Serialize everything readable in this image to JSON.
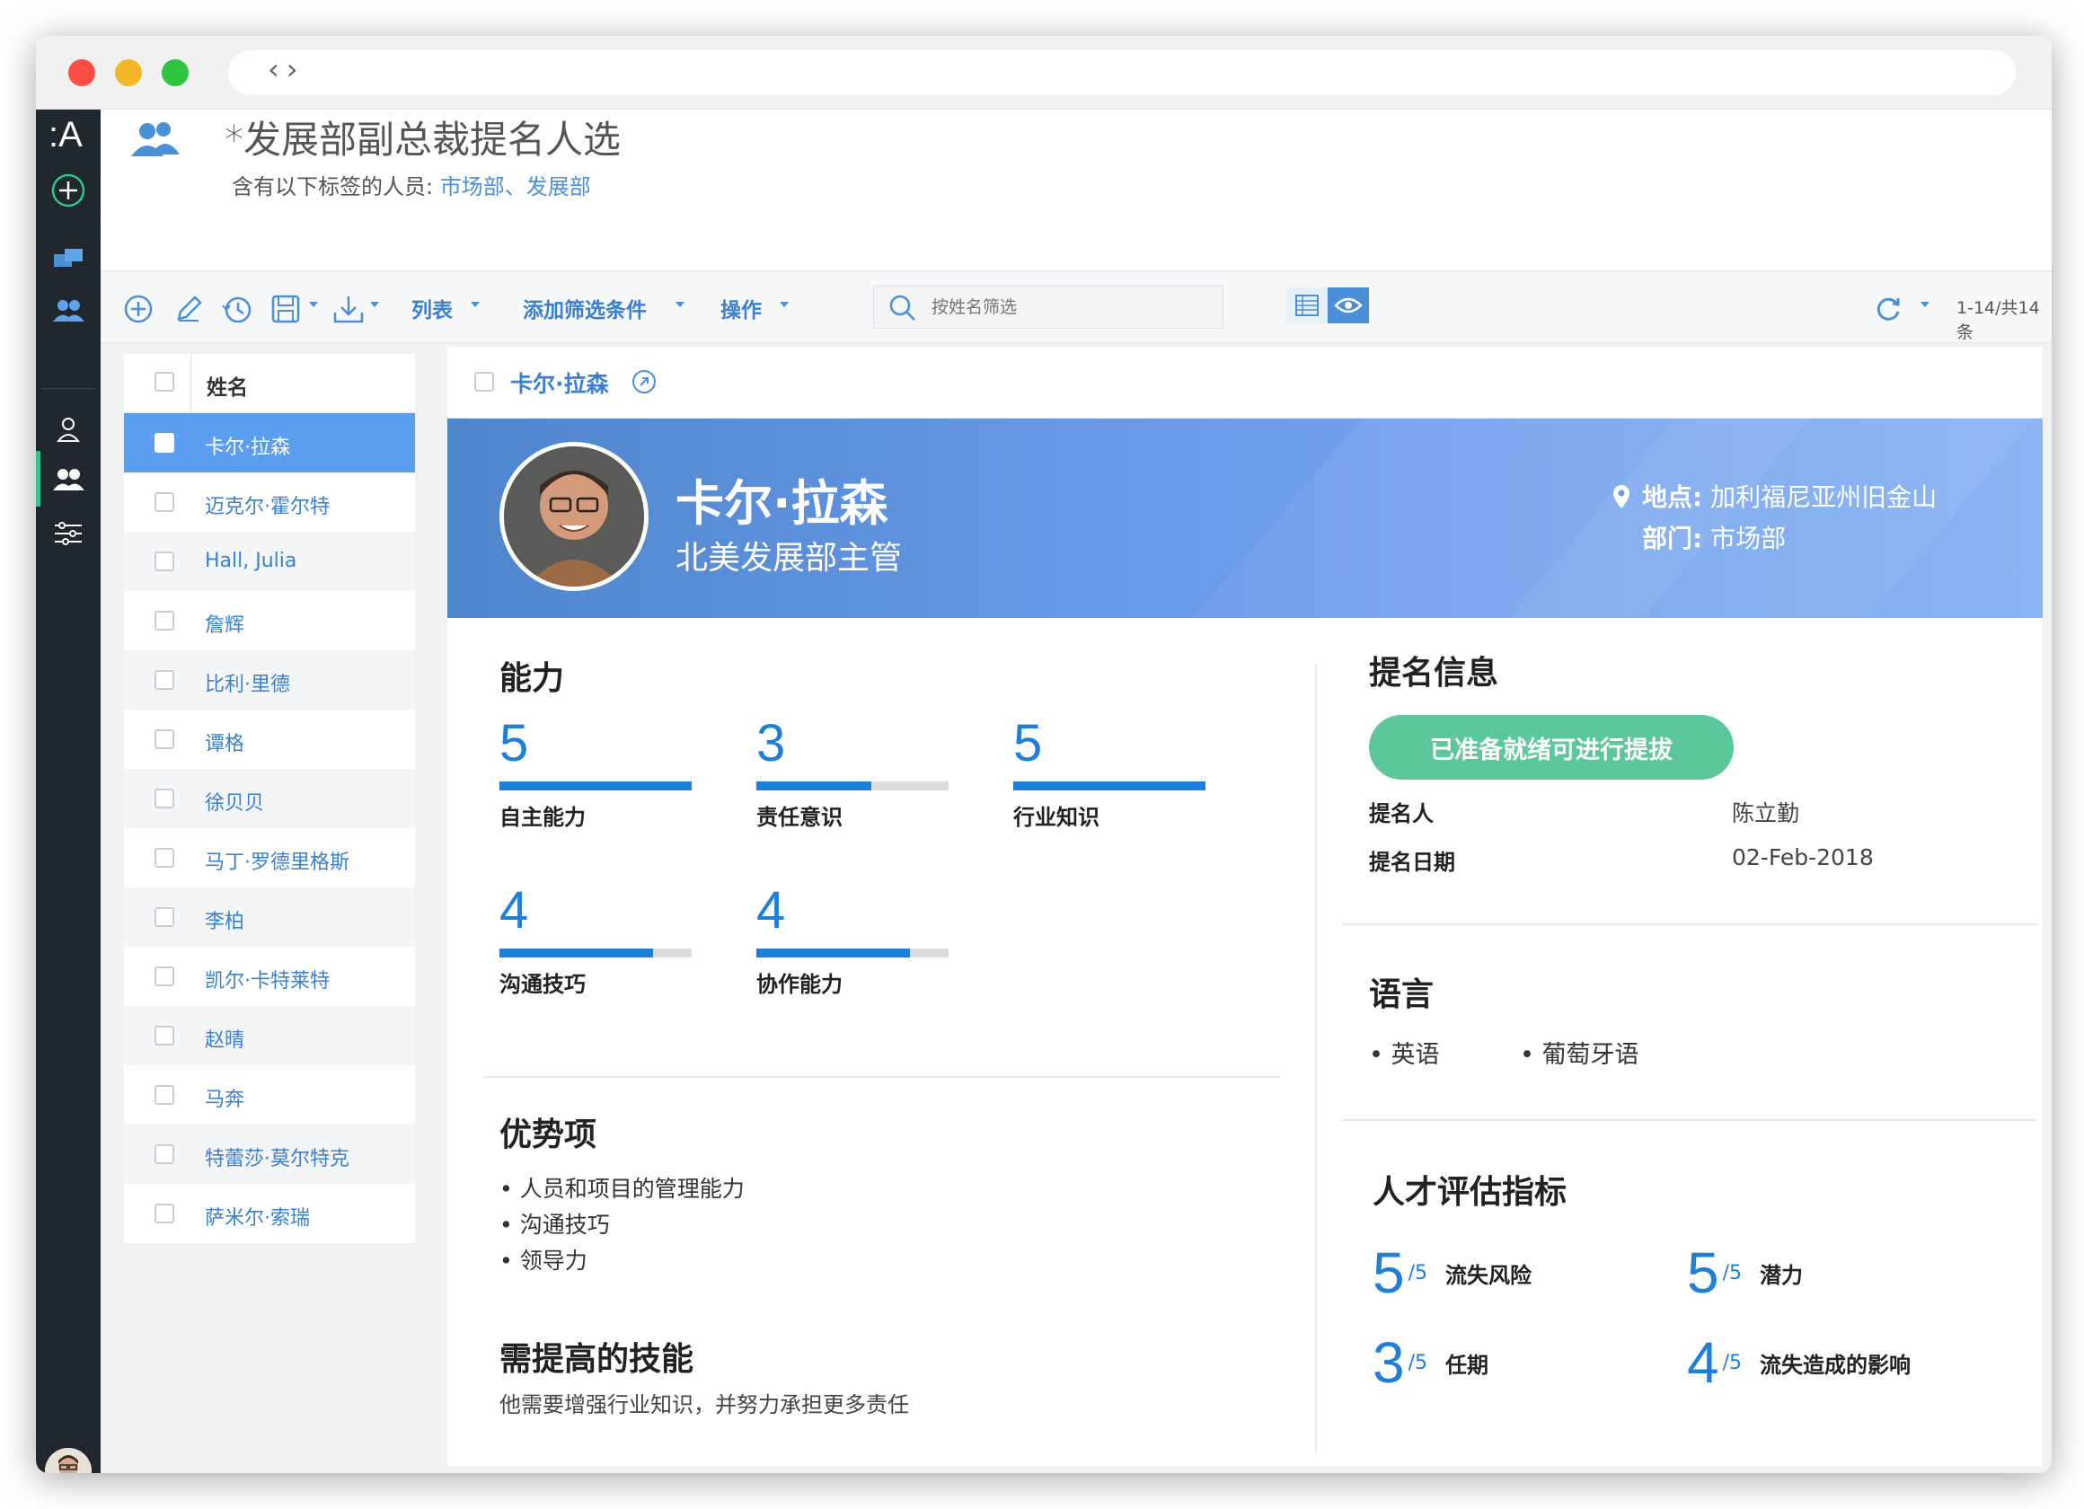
{
  "colors": {
    "accent": "#4a90d9",
    "selected_row": "#5b9ef0",
    "ready": "#5bc79a",
    "rail": "#20272f",
    "metric": "#1f7fd8"
  },
  "app": {
    "logo": ":A"
  },
  "header": {
    "title": "*发展部副总裁提名人选",
    "subtitle_prefix": "含有以下标签的人员: ",
    "subtitle_tags": "市场部、发展部"
  },
  "toolbar": {
    "list_label": "列表",
    "filter_label": "添加筛选条件",
    "actions_label": "操作",
    "search_placeholder": "按姓名筛选",
    "count": "1-14/共14条"
  },
  "list": {
    "header": "姓名",
    "rows": [
      "卡尔·拉森",
      "迈克尔·霍尔特",
      "Hall, Julia",
      "詹辉",
      "比利·里德",
      "谭格",
      "徐贝贝",
      "马丁·罗德里格斯",
      "李柏",
      "凯尔·卡特莱特",
      "赵晴",
      "马奔",
      "特蕾莎·莫尔特克",
      "萨米尔·索瑞"
    ],
    "selected_index": 0
  },
  "detail": {
    "link_name": "卡尔·拉森",
    "name": "卡尔·拉森",
    "title": "北美发展部主管",
    "location_label": "地点:",
    "location": "加利福尼亚州旧金山",
    "dept_label": "部门:",
    "dept": "市场部",
    "abilities_title": "能力",
    "abilities": [
      {
        "value": "5",
        "max": 5,
        "label": "自主能力"
      },
      {
        "value": "3",
        "max": 5,
        "label": "责任意识"
      },
      {
        "value": "5",
        "max": 5,
        "label": "行业知识"
      },
      {
        "value": "4",
        "max": 5,
        "label": "沟通技巧"
      },
      {
        "value": "4",
        "max": 5,
        "label": "协作能力"
      }
    ],
    "strengths_title": "优势项",
    "strengths": [
      "人员和项目的管理能力",
      "沟通技巧",
      "领导力"
    ],
    "improve_title": "需提高的技能",
    "improve_text": "他需要增强行业知识，并努力承担更多责任",
    "nomination_title": "提名信息",
    "ready_button": "已准备就绪可进行提拔",
    "nominator_label": "提名人",
    "nominator": "陈立勤",
    "date_label": "提名日期",
    "date": "02-Feb-2018",
    "language_title": "语言",
    "languages": [
      "英语",
      "葡萄牙语"
    ],
    "talent_title": "人才评估指标",
    "talent": [
      {
        "value": "5",
        "suffix": "/5",
        "label": "流失风险"
      },
      {
        "value": "5",
        "suffix": "/5",
        "label": "潜力"
      },
      {
        "value": "3",
        "suffix": "/5",
        "label": "任期"
      },
      {
        "value": "4",
        "suffix": "/5",
        "label": "流失造成的影响"
      }
    ]
  }
}
